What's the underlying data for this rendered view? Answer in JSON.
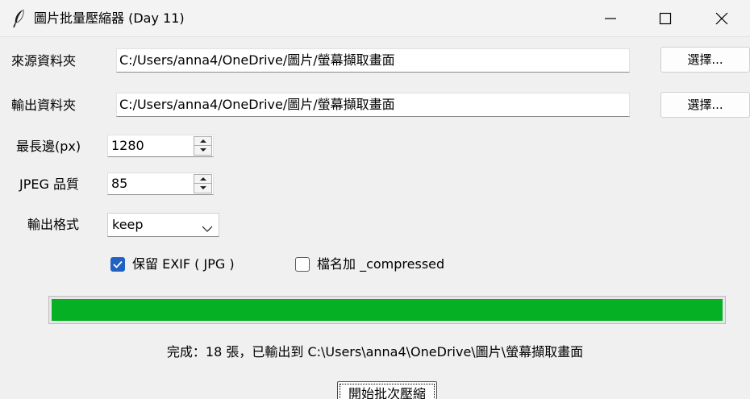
{
  "window": {
    "title": "圖片批量壓縮器 (Day 11)",
    "icon": "feather-icon",
    "controls": [
      "minimize-icon",
      "maximize-icon",
      "close-icon"
    ]
  },
  "form": {
    "source": {
      "label": "來源資料夾",
      "value": "C:/Users/anna4/OneDrive/圖片/螢幕擷取畫面",
      "button_label": "選擇..."
    },
    "output": {
      "label": "輸出資料夾",
      "value": "C:/Users/anna4/OneDrive/圖片/螢幕擷取畫面",
      "button_label": "選擇..."
    },
    "max_edge": {
      "label": "最長邊(px)",
      "value": "1280"
    },
    "jpeg_quality": {
      "label": "JPEG 品質",
      "value": "85"
    },
    "output_format": {
      "label": "輸出格式",
      "value": "keep"
    },
    "keep_exif": {
      "label": "保留 EXIF ( JPG )",
      "checked": true
    },
    "append_suffix": {
      "label": "檔名加 _compressed",
      "checked": false
    }
  },
  "progress": {
    "fraction": 1.0,
    "color": "#06b025"
  },
  "status": {
    "text": "完成：18 張，已輸出到 C:\\Users\\anna4\\OneDrive\\圖片\\螢幕擷取畫面"
  },
  "actions": {
    "start_label": "開始批次壓縮"
  },
  "colors": {
    "accent": "#2062c4",
    "progress": "#06b025",
    "background": "#f0f0f0"
  }
}
